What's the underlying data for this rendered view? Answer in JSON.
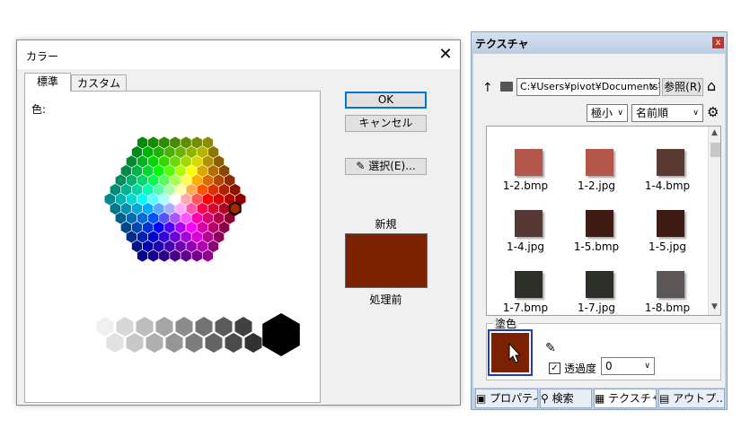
{
  "color_dialog": {
    "title": "カラー",
    "close": "✕",
    "tabs": [
      "標準",
      "カスタム"
    ],
    "color_label": "色:",
    "ok_label": "OK",
    "cancel_label": "キャンセル",
    "pick_label": "選択(E)...",
    "new_label": "新規",
    "prev_label": "処理前",
    "new_color": "#7b2000",
    "selected_color": "#a52a00"
  },
  "texture_panel": {
    "title": "テクスチャ",
    "close": "x",
    "path": "C:¥Users¥pivot¥Documents¥",
    "browse_label": "参照(R)",
    "size_option": "極小",
    "sort_option": "名前順",
    "items": [
      {
        "name": "1-2.bmp",
        "color": "#b4574a"
      },
      {
        "name": "1-2.jpg",
        "color": "#b4574a"
      },
      {
        "name": "1-4.bmp",
        "color": "#5a3a33"
      },
      {
        "name": "1-4.jpg",
        "color": "#563834"
      },
      {
        "name": "1-5.bmp",
        "color": "#3e1c14"
      },
      {
        "name": "1-5.jpg",
        "color": "#3e1c14"
      },
      {
        "name": "1-7.bmp",
        "color": "#2c2f28"
      },
      {
        "name": "1-7.jpg",
        "color": "#2c2f28"
      },
      {
        "name": "1-8.bmp",
        "color": "#5c5656"
      }
    ],
    "paint_label": "塗色",
    "paint_color": "#7b2000",
    "opacity_label": "透過度",
    "opacity_value": "0",
    "opacity_checked": "✓",
    "bottom_tabs": [
      "プロパティ",
      "検索",
      "テクスチャ",
      "アウトプ..."
    ]
  }
}
